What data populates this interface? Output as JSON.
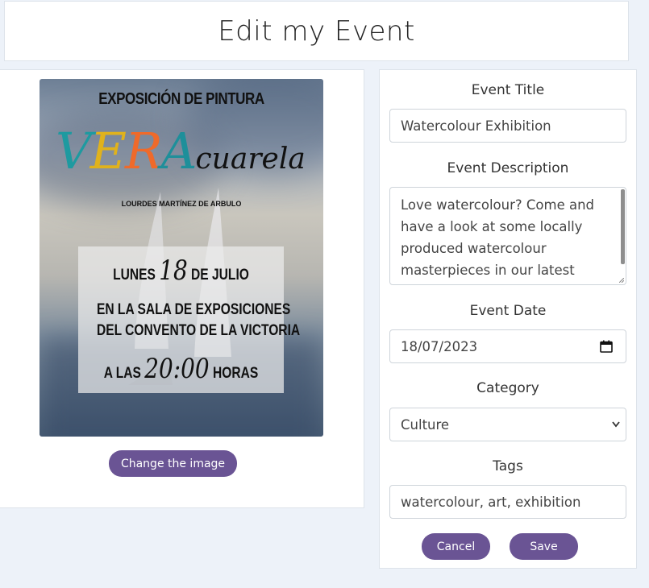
{
  "header": {
    "title": "Edit my Event"
  },
  "poster": {
    "heading": "EXPOSICIÓN DE PINTURA",
    "brand": {
      "v": "V",
      "e": "E",
      "r": "R",
      "a": "A",
      "rest": "cuarela"
    },
    "author": "LOURDES MARTÍNEZ DE ARBULO",
    "date_line": {
      "pre": "LUNES",
      "day": "18",
      "post": "DE JULIO"
    },
    "venue_line1": "EN LA SALA DE EXPOSICIONES",
    "venue_line2": "DEL CONVENTO DE LA VICTORIA",
    "time_line": {
      "pre": "A LAS",
      "time": "20:00",
      "post": "HORAS"
    }
  },
  "image_actions": {
    "change_label": "Change the image"
  },
  "form": {
    "title_label": "Event Title",
    "title_value": "Watercolour Exhibition",
    "description_label": "Event Description",
    "description_value": "Love watercolour? Come and have a look at some locally produced watercolour masterpieces in our latest exhibition",
    "date_label": "Event Date",
    "date_value": "18/07/2023",
    "category_label": "Category",
    "category_value": "Culture",
    "tags_label": "Tags",
    "tags_value": "watercolour, art, exhibition",
    "cancel_label": "Cancel",
    "save_label": "Save"
  },
  "colors": {
    "accent": "#6a5494",
    "page_bg": "#edf2f9"
  }
}
